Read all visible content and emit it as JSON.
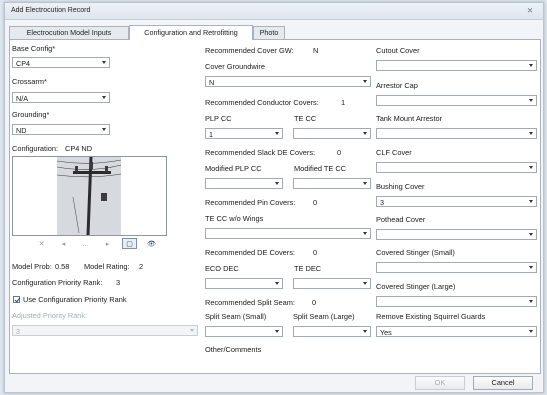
{
  "window": {
    "title": "Add Electrocution Record",
    "close_label": "⨯"
  },
  "tabs": [
    {
      "label": "Electrocution Model Inputs"
    },
    {
      "label": "Configuration and Retrofitting"
    },
    {
      "label": "Photo"
    }
  ],
  "left": {
    "base_config": {
      "label": "Base Config*",
      "value": "CP4"
    },
    "crossarm": {
      "label": "Crossarm*",
      "value": "N/A"
    },
    "grounding": {
      "label": "Grounding*",
      "value": "ND"
    },
    "configuration": {
      "label": "Configuration:",
      "value": "CP4 ND"
    },
    "model_prob": {
      "label": "Model Prob:",
      "value": "0.58"
    },
    "model_rating": {
      "label": "Model Rating:",
      "value": "2"
    },
    "priority_rank": {
      "label": "Configuration Priority Rank:",
      "value": "3"
    },
    "use_priority": {
      "label": "Use Configuration Priority Rank",
      "checked": true
    },
    "adjusted_rank": {
      "label": "Adjusted Priority Rank:",
      "value": "3"
    }
  },
  "middle": {
    "rec_cover_gw": {
      "label": "Recommended Cover GW:",
      "value": "N"
    },
    "cover_groundwire": {
      "label": "Cover Groundwire",
      "value": "N"
    },
    "rec_conductor_covers": {
      "label": "Recommended Conductor Covers:",
      "value": "1"
    },
    "plp_cc": {
      "label": "PLP CC",
      "value": "1"
    },
    "te_cc": {
      "label": "TE CC",
      "value": ""
    },
    "rec_slack_de": {
      "label": "Recommended Slack DE Covers:",
      "value": "0"
    },
    "mod_plp_cc": {
      "label": "Modified PLP CC",
      "value": ""
    },
    "mod_te_cc": {
      "label": "Modified TE CC",
      "value": ""
    },
    "rec_pin_covers": {
      "label": "Recommended Pin Covers:",
      "value": "0"
    },
    "te_cc_wo_wings": {
      "label": "TE CC w/o Wings",
      "value": ""
    },
    "rec_de_covers": {
      "label": "Recommended DE Covers:",
      "value": "0"
    },
    "eco_dec": {
      "label": "ECO DEC",
      "value": ""
    },
    "te_dec": {
      "label": "TE DEC",
      "value": ""
    },
    "rec_split_seam": {
      "label": "Recommended Split Seam:",
      "value": "0"
    },
    "split_seam_small": {
      "label": "Split Seam (Small)",
      "value": ""
    },
    "split_seam_large": {
      "label": "Split Seam (Large)",
      "value": ""
    },
    "other_comments": {
      "label": "Other/Comments"
    }
  },
  "right": {
    "cutout_cover": {
      "label": "Cutout Cover",
      "value": ""
    },
    "arrestor_cap": {
      "label": "Arrestor Cap",
      "value": ""
    },
    "tank_mount_arrestor": {
      "label": "Tank Mount Arrestor",
      "value": ""
    },
    "clf_cover": {
      "label": "CLF Cover",
      "value": ""
    },
    "bushing_cover": {
      "label": "Bushing Cover",
      "value": "3"
    },
    "pothead_cover": {
      "label": "Pothead Cover",
      "value": ""
    },
    "covered_stinger_small": {
      "label": "Covered Stinger (Small)",
      "value": ""
    },
    "covered_stinger_large": {
      "label": "Covered Stinger (Large)",
      "value": ""
    },
    "remove_squirrel_guards": {
      "label": "Remove Existing Squirrel Guards",
      "value": "Yes"
    }
  },
  "photo_toolbar": [
    {
      "icon": "close-icon",
      "glyph": "✕"
    },
    {
      "icon": "back-icon",
      "glyph": "◂"
    },
    {
      "icon": "ellipsis-icon",
      "glyph": "…"
    },
    {
      "icon": "forward-icon",
      "glyph": "▸"
    },
    {
      "icon": "window-icon",
      "glyph": "▢"
    },
    {
      "icon": "binoculars-icon",
      "glyph": "👁"
    }
  ],
  "footer": {
    "ok_label": "OK",
    "cancel_label": "Cancel"
  }
}
